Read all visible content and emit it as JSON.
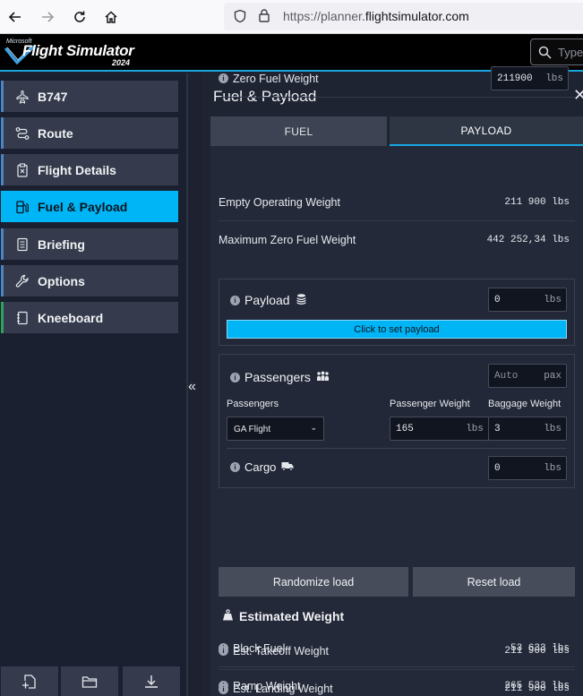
{
  "browser": {
    "url_prefix": "https://planner.",
    "url_domain": "flightsimulator.com"
  },
  "header": {
    "logo_microsoft": "Microsoft",
    "logo_title": "Flight Simulator",
    "logo_year": "2024",
    "search_placeholder": "Type"
  },
  "sidebar": {
    "items": [
      {
        "label": "B747",
        "icon": "airplane-icon"
      },
      {
        "label": "Route",
        "icon": "route-icon"
      },
      {
        "label": "Flight Details",
        "icon": "clipboard-icon"
      },
      {
        "label": "Fuel & Payload",
        "icon": "fuel-icon"
      },
      {
        "label": "Briefing",
        "icon": "document-icon"
      },
      {
        "label": "Options",
        "icon": "wrench-icon"
      },
      {
        "label": "Kneeboard",
        "icon": "notebook-icon"
      }
    ],
    "active": "Fuel & Payload",
    "bottom_buttons": [
      "new-plan-icon",
      "open-folder-icon",
      "download-icon"
    ]
  },
  "panel": {
    "title": "Fuel & Payload",
    "tabs": {
      "fuel": "FUEL",
      "payload": "PAYLOAD"
    },
    "zero_fuel_weight": {
      "label": "Zero Fuel Weight",
      "value": "211900",
      "unit": "lbs"
    },
    "empty_operating_weight": {
      "label": "Empty Operating Weight",
      "value": "211 900 lbs"
    },
    "max_zero_fuel_weight": {
      "label": "Maximum Zero Fuel Weight",
      "value": "442 252,34 lbs"
    },
    "payload": {
      "label": "Payload",
      "value": "0",
      "unit": "lbs",
      "set_button": "Click to set payload"
    },
    "passengers": {
      "label": "Passengers",
      "placeholder": "Auto",
      "unit": "pax",
      "type_label": "Passengers",
      "type_value": "GA Flight",
      "weight_label": "Passenger Weight",
      "weight_value": "165",
      "weight_unit": "lbs",
      "baggage_label": "Baggage Weight",
      "baggage_value": "3",
      "baggage_unit": "lbs"
    },
    "cargo": {
      "label": "Cargo",
      "value": "0",
      "unit": "lbs"
    },
    "buttons": {
      "randomize": "Randomize load",
      "reset": "Reset load"
    },
    "estimated": {
      "title": "Estimated Weight",
      "rows": [
        {
          "label": "Block Fuel",
          "value": "53 633 lbs"
        },
        {
          "label": "Ramp Weight",
          "value": "265 533 lbs"
        },
        {
          "label": "Est. Takeoff Weight",
          "value": "211 900 lbs"
        },
        {
          "label": "Est. Landing Weight",
          "value": "211 900 lbs"
        }
      ]
    }
  },
  "colors": {
    "accent": "#00b5f5",
    "background": "#1e2230"
  }
}
